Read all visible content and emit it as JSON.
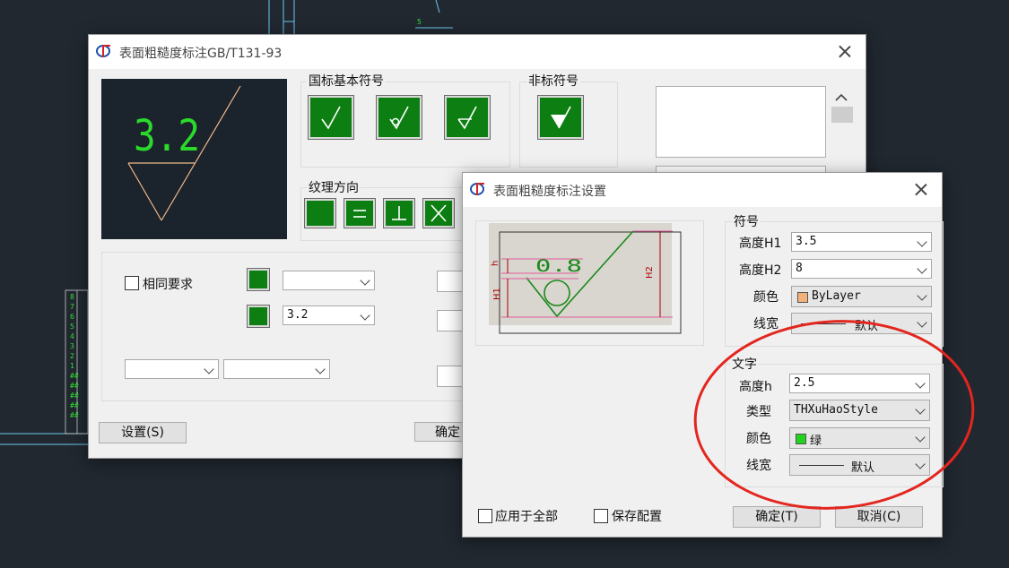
{
  "cad_bg": {
    "dim_number": "5",
    "side_rows": [
      "8",
      "7",
      "6",
      "5",
      "4",
      "3",
      "2",
      "1",
      "##",
      "##",
      "##",
      "##",
      "##"
    ]
  },
  "main_dialog": {
    "title": "表面粗糙度标注GB/T131-93",
    "preview_value": "3.2",
    "basic_symbols": {
      "label": "国标基本符号"
    },
    "nonstandard_symbols": {
      "label": "非标符号"
    },
    "texture_direction": {
      "label": "纹理方向"
    },
    "same_requirement": {
      "label": "相同要求",
      "checked": false
    },
    "value_combo_1": {
      "value": ""
    },
    "value_combo_2": {
      "value": "3.2"
    },
    "bottom_combo_1": {
      "value": ""
    },
    "bottom_combo_2": {
      "value": ""
    },
    "settings_button": "设置(S)",
    "ok_button": "确定"
  },
  "settings_dialog": {
    "title": "表面粗糙度标注设置",
    "preview": {
      "value": "0.8",
      "h_label": "h",
      "h1_label": "H1",
      "h2_label": "H2"
    },
    "symbol_group": {
      "label": "符号",
      "height_h1": {
        "label": "高度H1",
        "value": "3.5"
      },
      "height_h2": {
        "label": "高度H2",
        "value": "8"
      },
      "color": {
        "label": "颜色",
        "value": "ByLayer",
        "swatch": "#f2b27a"
      },
      "linewidth": {
        "label": "线宽",
        "value": "默认"
      }
    },
    "text_group": {
      "label": "文字",
      "height_h": {
        "label": "高度h",
        "value": "2.5"
      },
      "type": {
        "label": "类型",
        "value": "THXuHaoStyle"
      },
      "color": {
        "label": "颜色",
        "value": "绿",
        "swatch": "#1fd31f"
      },
      "linewidth": {
        "label": "线宽",
        "value": "默认"
      }
    },
    "apply_all": {
      "label": "应用于全部",
      "checked": false
    },
    "save_config": {
      "label": "保存配置",
      "checked": false
    },
    "ok_button": "确定(T)",
    "cancel_button": "取消(C)"
  },
  "annotation": {
    "circle_color": "#e3261e"
  }
}
